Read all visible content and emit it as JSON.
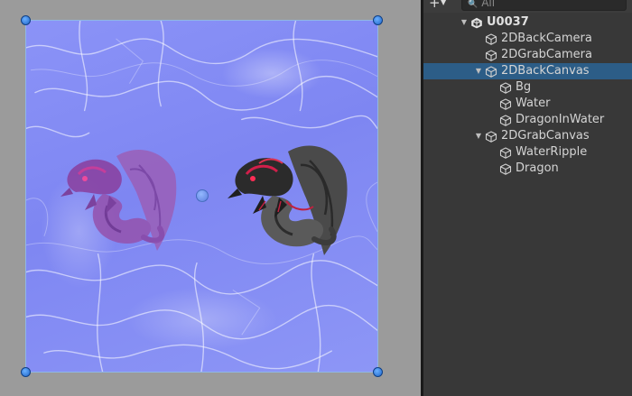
{
  "hierarchy": {
    "add_label": "+",
    "search_placeholder": "All",
    "items": [
      {
        "label": "U0037",
        "depth": 0,
        "type": "scene",
        "expanded": true
      },
      {
        "label": "2DBackCamera",
        "depth": 1,
        "type": "object"
      },
      {
        "label": "2DGrabCamera",
        "depth": 1,
        "type": "object"
      },
      {
        "label": "2DBackCanvas",
        "depth": 1,
        "type": "object",
        "expanded": true,
        "selected": true
      },
      {
        "label": "Bg",
        "depth": 2,
        "type": "object"
      },
      {
        "label": "Water",
        "depth": 2,
        "type": "object"
      },
      {
        "label": "DragonInWater",
        "depth": 2,
        "type": "object"
      },
      {
        "label": "2DGrabCanvas",
        "depth": 1,
        "type": "object",
        "expanded": true
      },
      {
        "label": "WaterRipple",
        "depth": 2,
        "type": "object"
      },
      {
        "label": "Dragon",
        "depth": 2,
        "type": "object"
      }
    ]
  },
  "colors": {
    "selection": "#2c5d87",
    "panel_bg": "#383838",
    "water": "#8b93f7",
    "handle": "#1f66c9"
  }
}
